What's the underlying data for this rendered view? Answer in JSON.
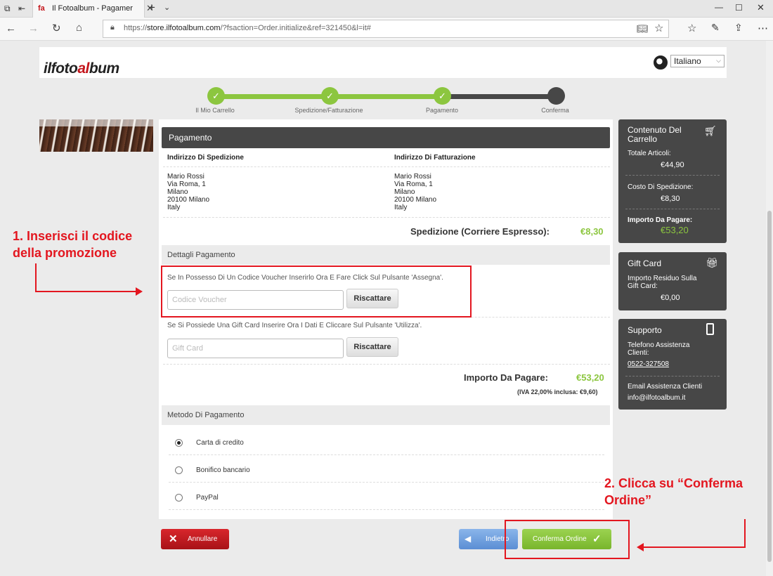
{
  "browser": {
    "tab_title": "Il Fotoalbum - Pagamer",
    "tab_favicon": "fa",
    "url_scheme": "https://",
    "url_domain": "store.ilfotoalbum.com",
    "url_path": "/?fsaction=Order.initialize&ref=321450&l=it#"
  },
  "header": {
    "logo_left": "ilfoto",
    "logo_mid": "al",
    "logo_right": "bum",
    "language": "Italiano"
  },
  "steps": [
    {
      "label": "Il Mio Carrello",
      "done": true
    },
    {
      "label": "Spedizione/Fatturazione",
      "done": true
    },
    {
      "label": "Pagamento",
      "done": true
    },
    {
      "label": "Conferma",
      "done": false
    }
  ],
  "main": {
    "title": "Pagamento",
    "shipping_heading": "Indirizzo Di Spedizione",
    "billing_heading": "Indirizzo Di Fatturazione",
    "shipping_address": [
      "Mario Rossi",
      "Via Roma, 1",
      "Milano",
      "20100 Milano",
      "Italy"
    ],
    "billing_address": [
      "Mario Rossi",
      "Via Roma, 1",
      "Milano",
      "20100 Milano",
      "Italy"
    ],
    "shipping_label": "Spedizione (Corriere Espresso):",
    "shipping_value": "€8,30",
    "payment_details_heading": "Dettagli Pagamento",
    "voucher_hint": "Se In Possesso Di Un Codice Voucher Inserirlo Ora E Fare Click Sul Pulsante 'Assegna'.",
    "voucher_placeholder": "Codice Voucher",
    "voucher_button": "Riscattare",
    "giftcard_hint": "Se Si Possiede Una Gift Card Inserire Ora I Dati E Cliccare Sul Pulsante 'Utilizza'.",
    "giftcard_placeholder": "Gift Card",
    "giftcard_button": "Riscattare",
    "total_label": "Importo Da Pagare:",
    "total_value": "€53,20",
    "vat_note": "(IVA 22,00% inclusa: €9,60)",
    "payment_method_heading": "Metodo Di Pagamento",
    "payment_methods": [
      {
        "label": "Carta di credito",
        "selected": true
      },
      {
        "label": "Bonifico bancario",
        "selected": false
      },
      {
        "label": "PayPal",
        "selected": false
      }
    ]
  },
  "sidebar": {
    "cart_title": "Contenuto Del Carrello",
    "total_items_label": "Totale Articoli:",
    "total_items_value": "€44,90",
    "shipping_cost_label": "Costo Di Spedizione:",
    "shipping_cost_value": "€8,30",
    "amount_due_label": "Importo Da Pagare:",
    "amount_due_value": "€53,20",
    "giftcard_title": "Gift Card",
    "giftcard_residual_label": "Importo Residuo Sulla Gift Card:",
    "giftcard_residual_value": "€0,00",
    "support_title": "Supporto",
    "support_phone_label": "Telefono Assistenza Clienti:",
    "support_phone": "0522-327508",
    "support_email_label": "Email Assistenza Clienti",
    "support_email": "info@ilfotoalbum.it"
  },
  "actions": {
    "cancel": "Annullare",
    "back": "Indietro",
    "confirm": "Conferma Ordine"
  },
  "annotations": {
    "note1_line1": "1. Inserisci il codice",
    "note1_line2": "della promozione",
    "note2_line1": "2. Clicca su “Conferma",
    "note2_line2": "Ordine”"
  },
  "colors": {
    "accent_green": "#8cc63f",
    "dark_panel": "#474747",
    "annotation_red": "#e3161f",
    "cancel_red": "#c4161c",
    "back_blue": "#6a9ad8"
  }
}
